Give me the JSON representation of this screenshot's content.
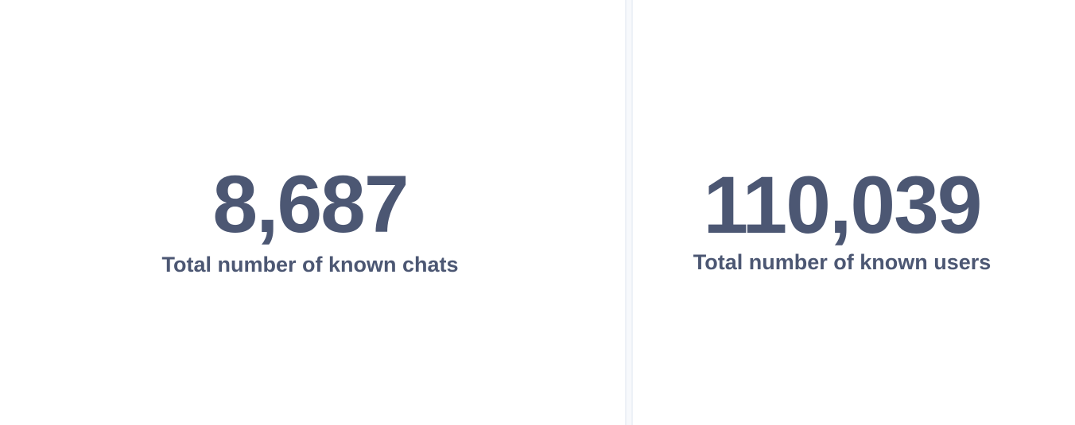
{
  "cards": [
    {
      "value": "8,687",
      "title": "Total number of known chats"
    },
    {
      "value": "110,039",
      "title": "Total number of known users"
    }
  ],
  "colors": {
    "text": "#4c5773",
    "background": "#ffffff",
    "divider": "#edf1f7"
  }
}
